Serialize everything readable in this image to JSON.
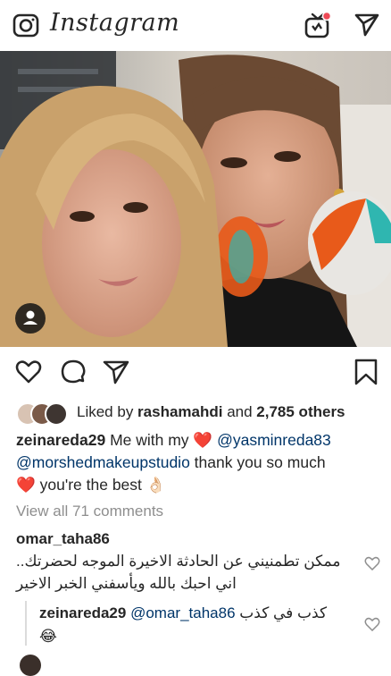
{
  "header": {
    "logo": "Instagram",
    "camera_icon": "camera-icon",
    "igtv_icon": "igtv-icon",
    "direct_icon": "paper-plane-icon",
    "notification_color": "#ed4956"
  },
  "post": {
    "usertag_icon": "user-tag-icon",
    "actions": [
      "heart-icon",
      "comment-icon",
      "share-icon",
      "bookmark-icon"
    ],
    "likes": {
      "prefix": "Liked by ",
      "user": "rashamahdi",
      "middle": " and ",
      "count": "2,785 others"
    },
    "caption": {
      "user": "zeinareda29",
      "text1": " Me with my ",
      "heart": "❤️",
      "mention1": " @yasminreda83",
      "mention2": "@morshedmakeupstudio",
      "text2": " thank you so much",
      "heart2": "❤️",
      "text3": " you're the best ",
      "emoji": "👌🏻"
    },
    "view_all": "View all 71 comments",
    "comments": [
      {
        "user": "omar_taha86",
        "text": "ممكن تطمنيني عن الحادثة الاخيرة الموجه لحضرتك.. اني احبك بالله ويأسفني الخبر الاخير"
      }
    ],
    "reply": {
      "user": "zeinareda29",
      "mention": "@omar_taha86",
      "text": " كذب في كذب",
      "emoji": "😂"
    }
  }
}
